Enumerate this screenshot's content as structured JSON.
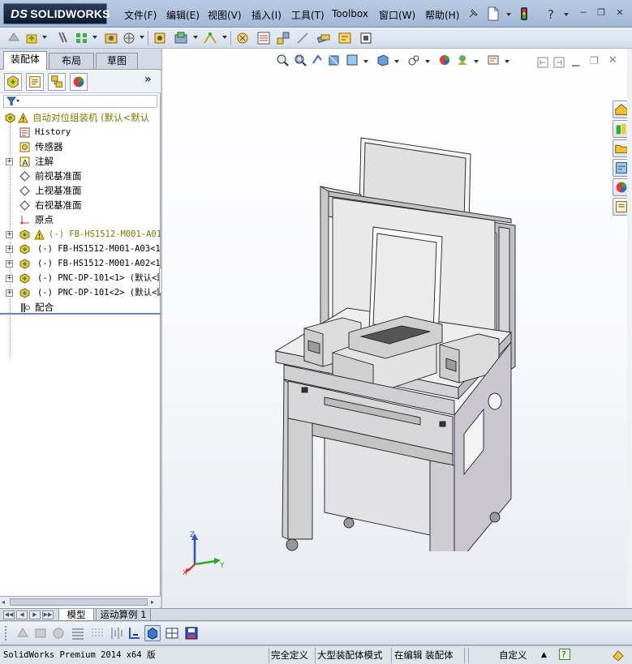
{
  "app": {
    "brand_prefix": "DS",
    "brand_name": "SOLIDWORKS"
  },
  "menu": {
    "items": [
      "文件(F)",
      "编辑(E)",
      "视图(V)",
      "插入(I)",
      "工具(T)",
      "Toolbox",
      "窗口(W)",
      "帮助(H)"
    ]
  },
  "left_panel": {
    "tabs": [
      "装配体",
      "布局",
      "草图"
    ],
    "expand_arrows": "»"
  },
  "tree": {
    "root": "自动对位组装机  (默认<默认",
    "items": [
      {
        "label": "History",
        "icon": "history-icon"
      },
      {
        "label": "传感器",
        "icon": "sensor-icon"
      },
      {
        "label": "注解",
        "icon": "annotation-icon"
      },
      {
        "label": "前视基准面",
        "icon": "plane-icon"
      },
      {
        "label": "上视基准面",
        "icon": "plane-icon"
      },
      {
        "label": "右视基准面",
        "icon": "plane-icon"
      },
      {
        "label": "原点",
        "icon": "origin-icon"
      },
      {
        "label": "(-) FB-HS1512-M001-A01<",
        "icon": "component-icon"
      },
      {
        "label": "(-) FB-HS1512-M001-A03<1>",
        "icon": "component-icon"
      },
      {
        "label": "(-) FB-HS1512-M001-A02<1>",
        "icon": "component-icon"
      },
      {
        "label": "(-) PNC-DP-101<1> (默认<默",
        "icon": "component-icon"
      },
      {
        "label": "(-) PNC-DP-101<2> (默认<默",
        "icon": "component-icon"
      },
      {
        "label": "配合",
        "icon": "mates-icon"
      }
    ]
  },
  "bottom_tabs": [
    "模型",
    "运动算例 1"
  ],
  "triad": {
    "z": "Z",
    "y": "Y",
    "x": "X"
  },
  "status": {
    "product": "SolidWorks Premium 2014 x64 版",
    "definition": "完全定义",
    "mode": "大型装配体模式",
    "editing": "在编辑 装配体",
    "units": "自定义"
  },
  "colors": {
    "accent": "#6b88b4",
    "warning": "#e8b800",
    "component": "#3aa84a"
  }
}
